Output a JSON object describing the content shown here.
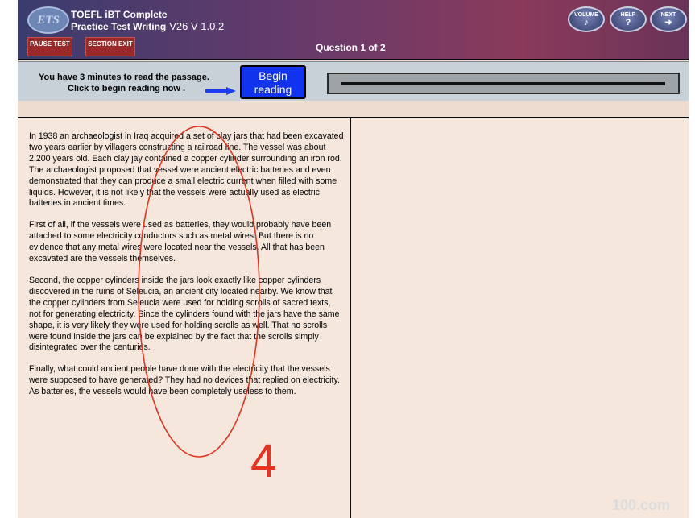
{
  "header": {
    "logo_text": "ETS",
    "title_line1": "TOEFL iBT Complete",
    "title_line2": "Practice Test Writing",
    "version": "V26  V 1.0.2",
    "question_counter": "Question 1 of 2",
    "pause_label": "PAUSE TEST",
    "section_exit_label": "SECTION EXIT",
    "volume_label": "VOLUME",
    "help_label": "HELP",
    "next_label": "NEXT"
  },
  "instruction": {
    "line1": "You have 3 minutes to read the passage.",
    "line2": "Click to begin reading now .",
    "begin_button_line1": "Begin",
    "begin_button_line2": "reading",
    "progress": 1.0
  },
  "passage": {
    "paragraphs": [
      "In 1938 an archaeologist in Iraq acquired a set of clay jars that had been excavated two years earlier by villagers constructing a railroad line. The vessel was about 2,200 years old. Each clay jay contained a copper cylinder surrounding an iron rod. The archaeologist proposed that vessel were ancient electric batteries and even demonstrated that they can produce a small electric current when filled with some liquids. However, it is not likely that the vessels were actually used as electric batteries in ancient times.",
      "First of all, if the vessels were used as batteries, they would probably have been attached to some electricity conductors such as metal wires. But there is no evidence that any metal wires were located near the vessels. All that has been excavated are the vessels themselves.",
      "Second, the copper cylinders inside the jars look exactly like copper cylinders discovered in the ruins of Seleucia, an ancient city located nearby. We know that the copper cylinders from Seleucia were used for holding scrolls of sacred texts, not for generating electricity. Since the cylinders found with the jars have the same shape, it is very likely they were used for holding scrolls as well. That no scrolls were found inside the jars can be explained by the fact that the scrolls simply disintegrated over the centuries.",
      "Finally, what could ancient people have done with the electricity that the vessels were supposed to have generated? They had no devices that replied on electricity. As batteries, the vessels would have been completely useless to them."
    ]
  },
  "annotation": {
    "handwritten_number": "4",
    "ink_color": "#e8321e"
  },
  "watermark": "100.com"
}
